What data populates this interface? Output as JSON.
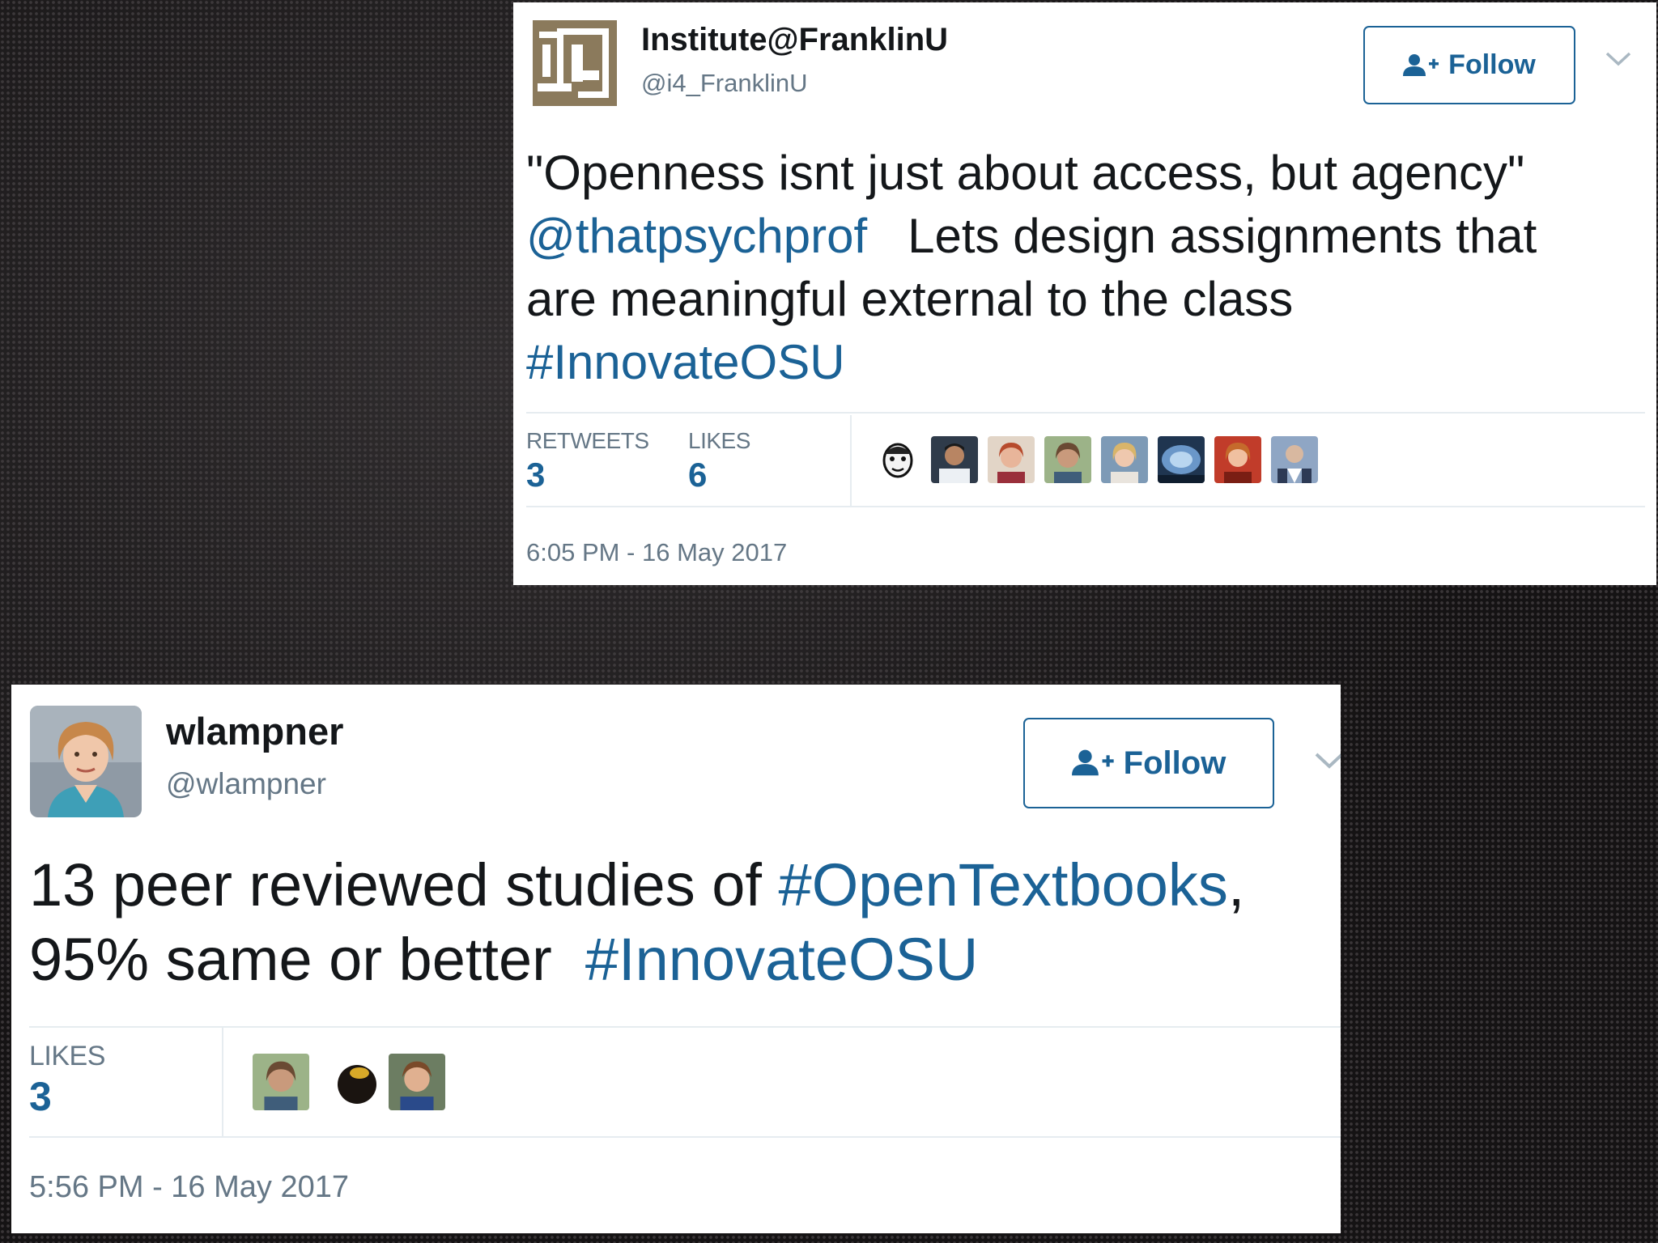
{
  "tweets": [
    {
      "name": "Institute@FranklinU",
      "handle": "@i4_FranklinU",
      "follow_label": "Follow",
      "text": {
        "line1": "\"Openness isnt just about access, but agency\"",
        "mention": "@thatpsychprof",
        "line2_rest": "Lets design assignments that",
        "line3": "are meaningful external to the class",
        "hashtag": "#InnovateOSU"
      },
      "retweets_label": "RETWEETS",
      "retweets": "3",
      "likes_label": "LIKES",
      "likes": "6",
      "timestamp": "6:05 PM - 16 May 2017",
      "liker_count": 8
    },
    {
      "name": "wlampner",
      "handle": "@wlampner",
      "follow_label": "Follow",
      "text": {
        "line1_plain": "13 peer reviewed studies of",
        "line1_hashtag": "#OpenTextbooks",
        "line1_end": ",",
        "line2_plain": "95% same or better",
        "line2_hashtag": "#InnovateOSU"
      },
      "likes_label": "LIKES",
      "likes": "3",
      "timestamp": "5:56 PM - 16 May 2017",
      "liker_count": 3
    }
  ],
  "colors": {
    "link": "#1b6296",
    "text": "#14171a",
    "muted": "#657786",
    "divider": "#e6ecf0",
    "logo_gold": "#8b7a5c"
  },
  "icons": [
    "follow-person-icon",
    "chevron-down-icon"
  ]
}
